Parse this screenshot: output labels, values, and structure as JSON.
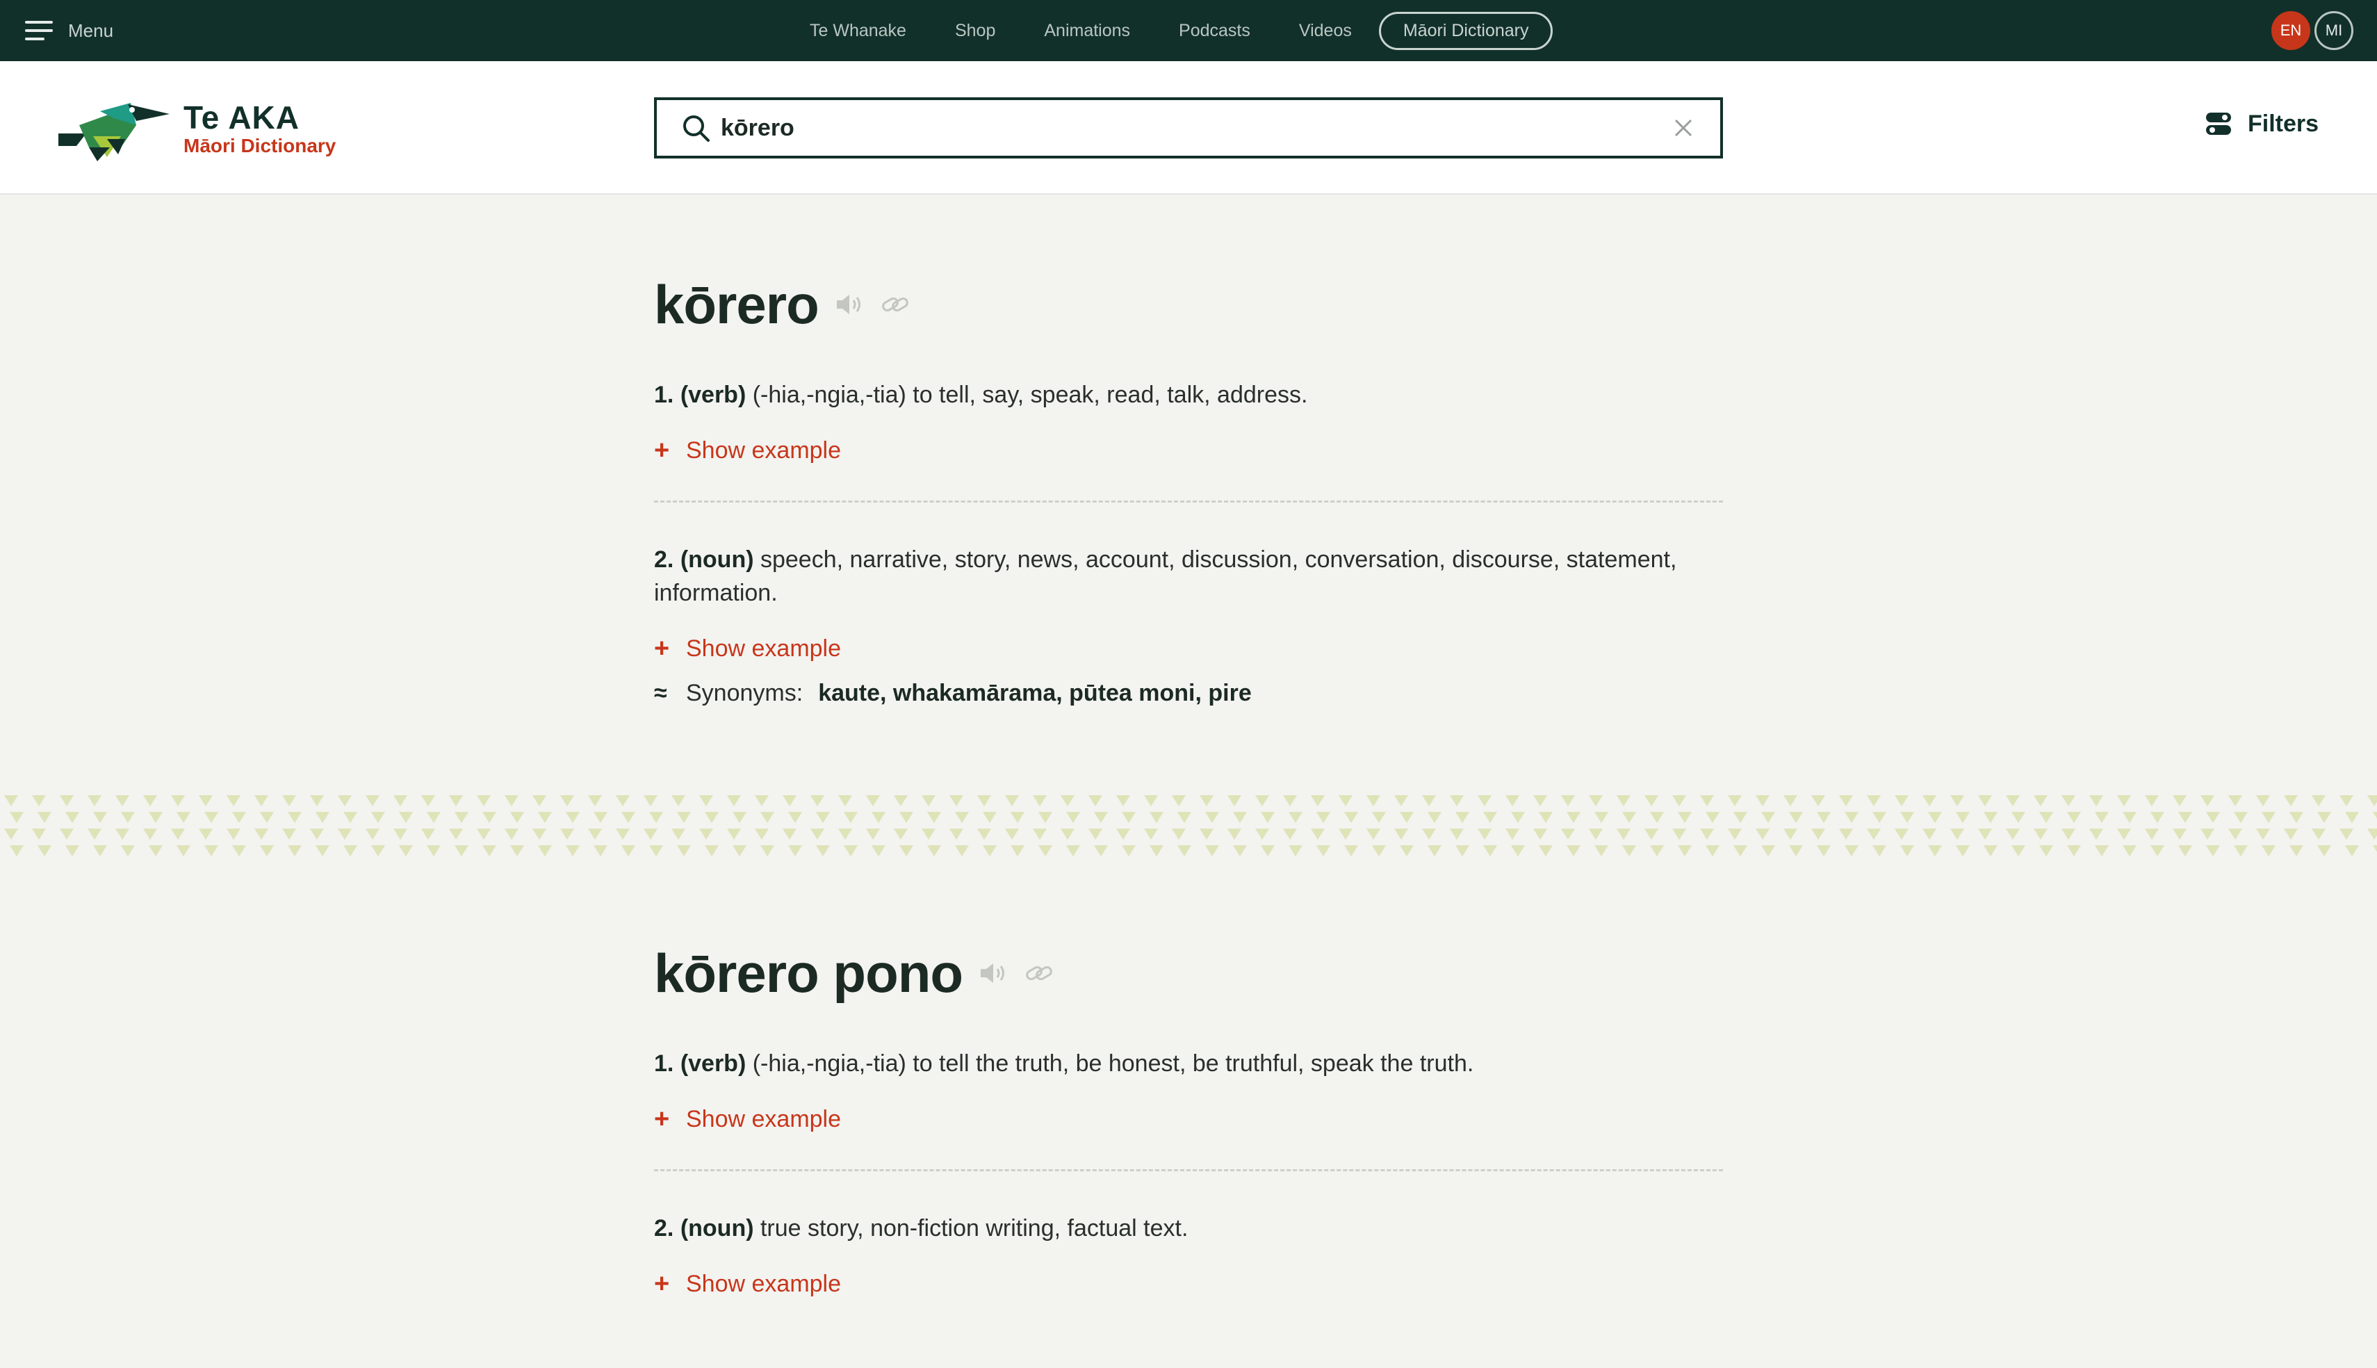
{
  "topnav": {
    "menu_label": "Menu",
    "links": [
      "Te Whanake",
      "Shop",
      "Animations",
      "Podcasts",
      "Videos"
    ],
    "active_link": "Māori Dictionary",
    "lang_en": "EN",
    "lang_mi": "MI",
    "active_lang_color": "#c7361a"
  },
  "header": {
    "logo_title": "Te AKA",
    "logo_subtitle": "Māori Dictionary",
    "search_value": "kōrero",
    "filters_label": "Filters"
  },
  "entries": [
    {
      "headword": "kōrero",
      "senses": [
        {
          "number": "1.",
          "pos": "(verb)",
          "text": "(-hia,-ngia,-tia) to tell, say, speak, read, talk, address.",
          "show_example": "Show example"
        },
        {
          "number": "2.",
          "pos": "(noun)",
          "text": "speech, narrative, story, news, account, discussion, conversation, discourse, statement, information.",
          "show_example": "Show example",
          "synonyms_label": "Synonyms:",
          "synonyms": "kaute, whakamārama, pūtea moni, pire"
        }
      ]
    },
    {
      "headword": "kōrero pono",
      "senses": [
        {
          "number": "1.",
          "pos": "(verb)",
          "text": "(-hia,-ngia,-tia) to tell the truth, be honest, be truthful, speak the truth.",
          "show_example": "Show example"
        },
        {
          "number": "2.",
          "pos": "(noun)",
          "text": "true story, non-fiction writing, factual text.",
          "show_example": "Show example"
        }
      ]
    }
  ],
  "colors": {
    "nav_bg": "#12302a",
    "accent": "#c7361a",
    "page_bg": "#f3f3f0",
    "pattern": "#dfe3b8"
  },
  "icons": [
    "hamburger-icon",
    "search-icon",
    "clear-icon",
    "filters-icon",
    "speaker-icon",
    "link-icon",
    "plus-icon",
    "synonyms-icon"
  ]
}
